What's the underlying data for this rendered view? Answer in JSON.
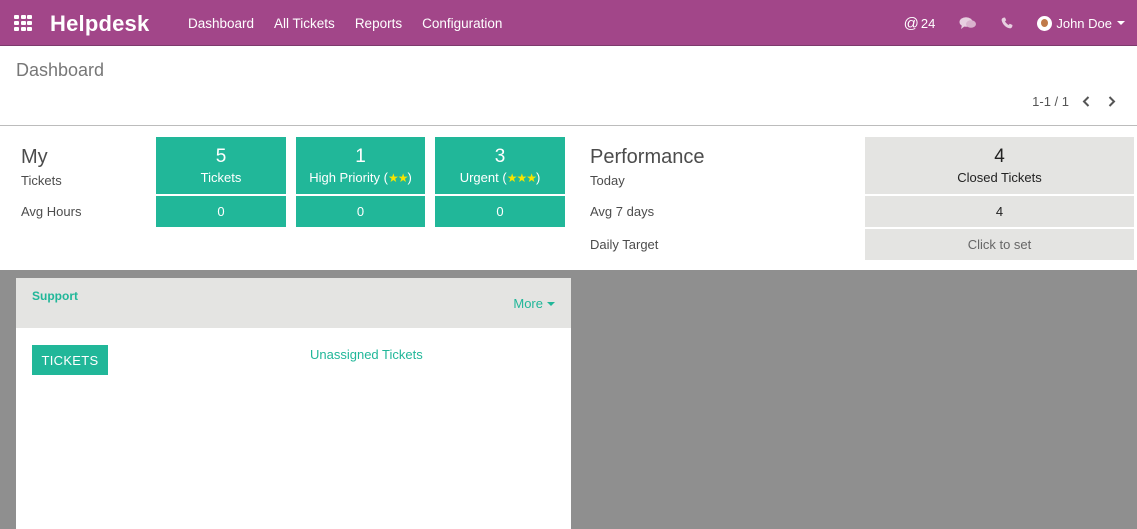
{
  "navbar": {
    "brand": "Helpdesk",
    "menu": [
      "Dashboard",
      "All Tickets",
      "Reports",
      "Configuration"
    ],
    "mentions_count": "24",
    "user_name": "John Doe"
  },
  "control_panel": {
    "title": "Dashboard",
    "pager": "1-1 / 1"
  },
  "my": {
    "heading": "My",
    "row_tickets": "Tickets",
    "row_avg_hours": "Avg Hours",
    "tiles": [
      {
        "count": "5",
        "label": "Tickets",
        "stars": "",
        "suffix_open": "",
        "suffix_close": "",
        "avg": "0"
      },
      {
        "count": "1",
        "label": "High Priority",
        "stars": "★★",
        "suffix_open": "(",
        "suffix_close": ")",
        "avg": "0"
      },
      {
        "count": "3",
        "label": "Urgent",
        "stars": "★★★",
        "suffix_open": "(",
        "suffix_close": ")",
        "avg": "0"
      }
    ]
  },
  "performance": {
    "heading": "Performance",
    "row_today": "Today",
    "row_avg_7": "Avg 7 days",
    "row_daily_target": "Daily Target",
    "today_count": "4",
    "today_label": "Closed Tickets",
    "avg_7_value": "4",
    "daily_target_value": "Click to set"
  },
  "team_card": {
    "title": "Support",
    "more": "More",
    "tickets_button": "TICKETS",
    "unassigned_link": "Unassigned Tickets"
  },
  "colors": {
    "navbar": "#a24689",
    "accent": "#21b799",
    "grey_tile": "#e4e4e2",
    "star": "#f6e400",
    "background": "#8f8f8f"
  }
}
